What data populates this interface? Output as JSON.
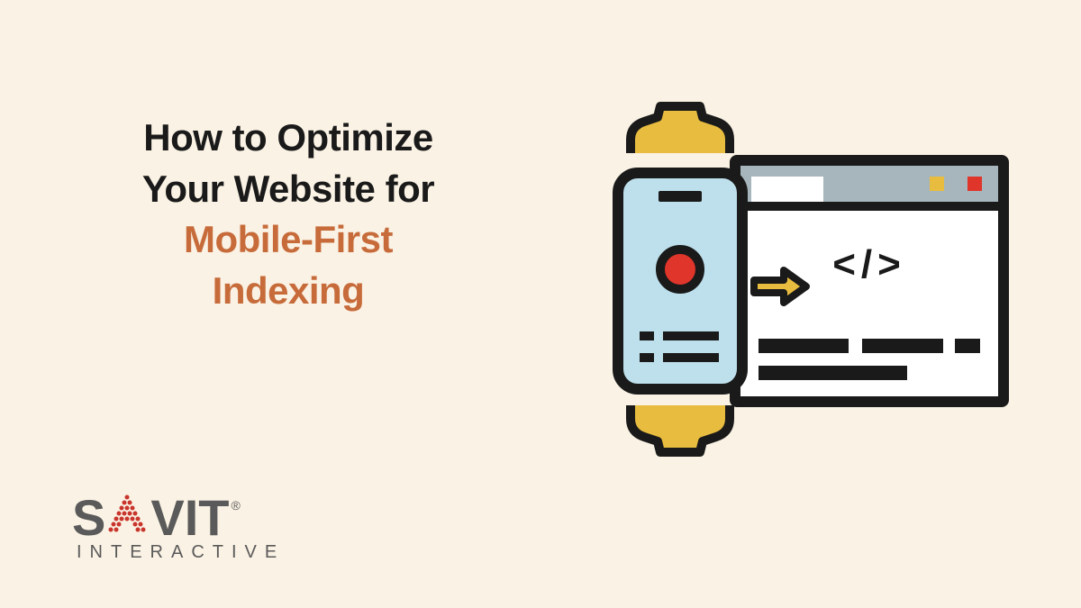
{
  "heading": {
    "line1": "How to Optimize",
    "line2": "Your Website for",
    "line3": "Mobile-First",
    "line4": "Indexing"
  },
  "logo": {
    "brand": "SAVIT",
    "subtitle": "INTERACTIVE",
    "registered": "®"
  },
  "illustration": {
    "code_symbol": "</>"
  },
  "colors": {
    "background": "#faf2e4",
    "text_dark": "#1a1a1a",
    "text_accent": "#c76b3a",
    "logo_gray": "#5a5a5a",
    "logo_red": "#c9352c",
    "gear_yellow": "#e8bc3f",
    "phone_blue": "#bde0ec",
    "browser_gray": "#a7b6bd",
    "red_dot": "#e0352b"
  }
}
